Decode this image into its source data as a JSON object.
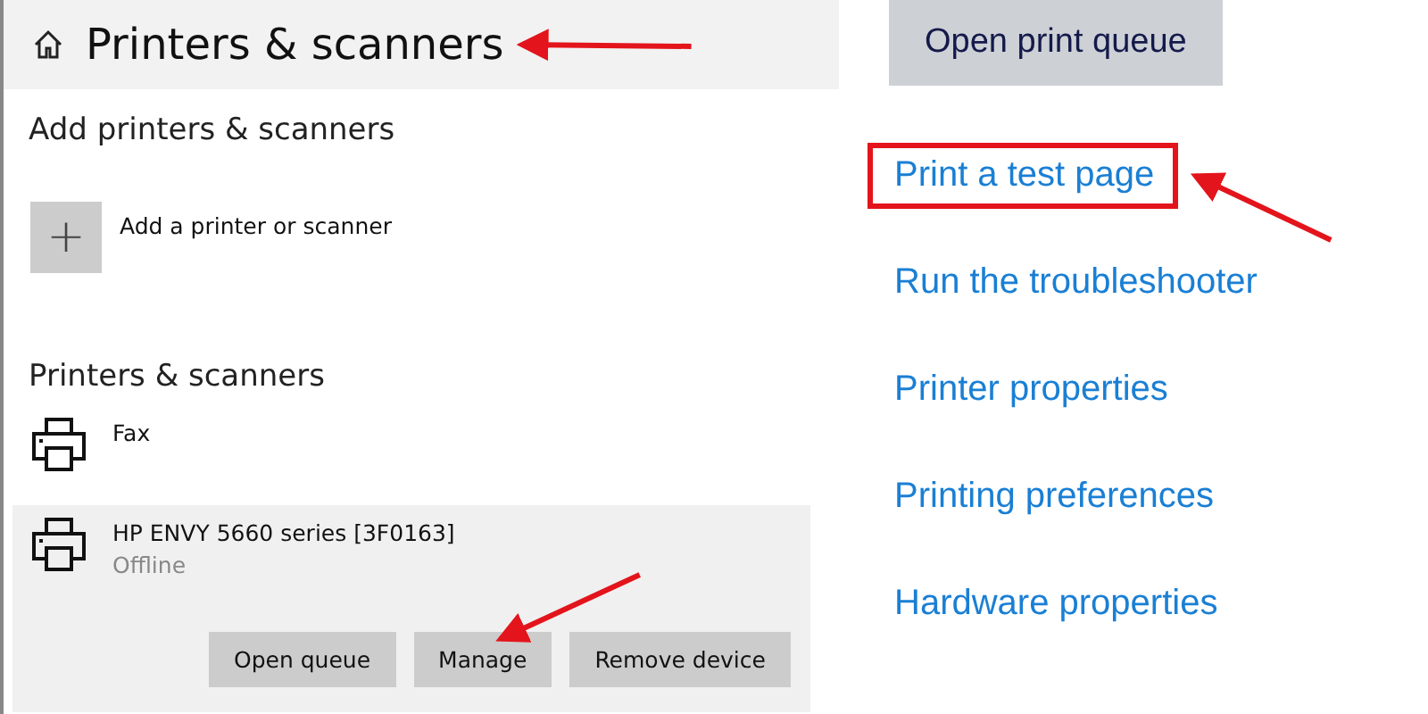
{
  "settings": {
    "title": "Printers & scanners",
    "title_pointed": true,
    "add_section": {
      "heading": "Add printers & scanners",
      "add_button_icon": "+",
      "add_label": "Add a printer or scanner"
    },
    "printers_section": {
      "heading": "Printers & scanners",
      "printers": [
        {
          "name": "Fax",
          "selected": false
        },
        {
          "name": "HP ENVY 5660 series [3F0163]",
          "status": "Offline",
          "selected": true,
          "buttons": [
            {
              "label": "Open queue",
              "pointed": false
            },
            {
              "label": "Manage",
              "pointed": true
            },
            {
              "label": "Remove device",
              "pointed": false
            }
          ]
        }
      ]
    }
  },
  "manage": {
    "open_queue_button": "Open print queue",
    "links": [
      {
        "label": "Print a test page",
        "highlighted": true,
        "pointed": true
      },
      {
        "label": "Run the troubleshooter",
        "highlighted": false,
        "pointed": false
      },
      {
        "label": "Printer properties",
        "highlighted": false,
        "pointed": false
      },
      {
        "label": "Printing preferences",
        "highlighted": false,
        "pointed": false
      },
      {
        "label": "Hardware properties",
        "highlighted": false,
        "pointed": false
      }
    ]
  }
}
